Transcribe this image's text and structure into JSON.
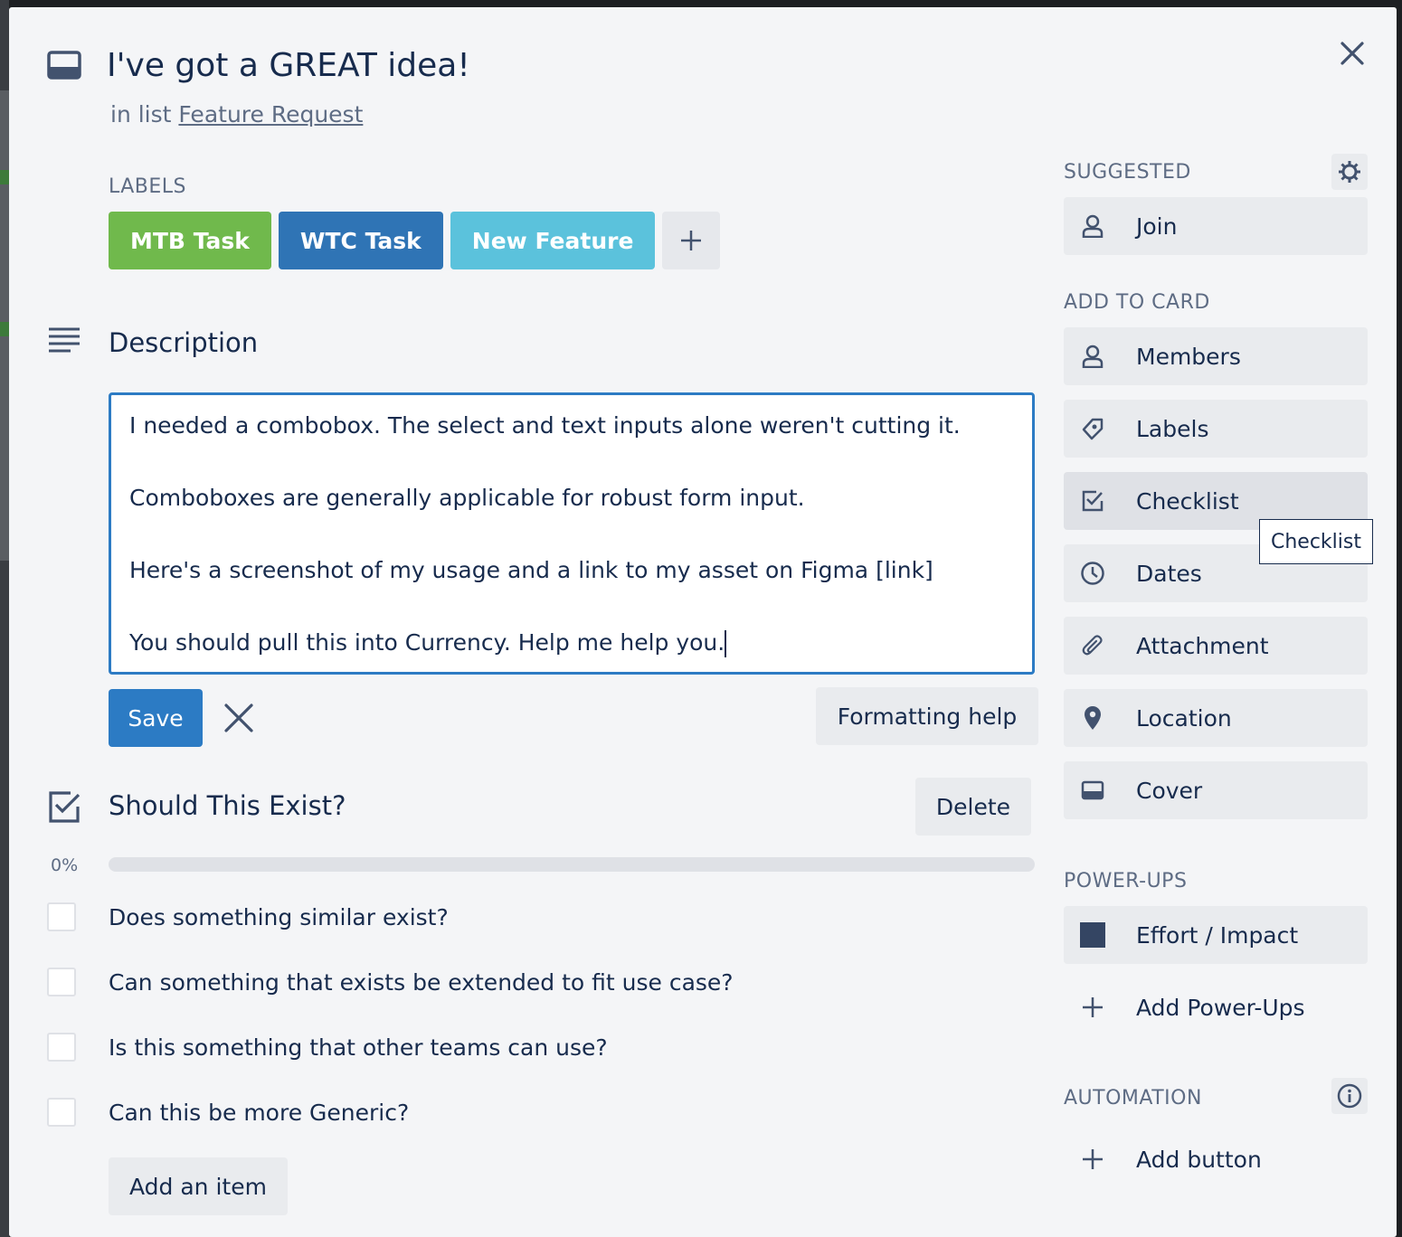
{
  "card": {
    "title": "I've got a GREAT idea!",
    "list_prefix": "in list",
    "list_name": "Feature Request"
  },
  "labels": {
    "heading": "LABELS",
    "items": [
      {
        "text": "MTB Task",
        "color": "#70b94c"
      },
      {
        "text": "WTC Task",
        "color": "#2f74b5"
      },
      {
        "text": "New Feature",
        "color": "#5bc2dc"
      }
    ]
  },
  "description": {
    "heading": "Description",
    "lines": [
      "I needed a combobox. The select and text inputs alone weren't cutting it.",
      "Comboboxes are generally applicable for robust form input.",
      "Here's a screenshot of my usage and a link to my asset on Figma [link]",
      "You should pull this into Currency. Help me help you."
    ],
    "save_label": "Save",
    "formatting_help_label": "Formatting help"
  },
  "checklist": {
    "title": "Should This Exist?",
    "delete_label": "Delete",
    "progress_text": "0%",
    "progress_value": 0,
    "items": [
      {
        "text": "Does something similar exist?",
        "checked": false
      },
      {
        "text": "Can something that exists be extended to fit use case?",
        "checked": false
      },
      {
        "text": "Is this something that other teams can use?",
        "checked": false
      },
      {
        "text": "Can this be more Generic?",
        "checked": false
      }
    ],
    "add_item_label": "Add an item"
  },
  "sidebar": {
    "suggested_heading": "SUGGESTED",
    "join_label": "Join",
    "add_to_card_heading": "ADD TO CARD",
    "add_to_card": [
      {
        "label": "Members",
        "icon": "person-icon"
      },
      {
        "label": "Labels",
        "icon": "tag-icon"
      },
      {
        "label": "Checklist",
        "icon": "checkbox-icon"
      },
      {
        "label": "Dates",
        "icon": "clock-icon"
      },
      {
        "label": "Attachment",
        "icon": "paperclip-icon"
      },
      {
        "label": "Location",
        "icon": "pin-icon"
      },
      {
        "label": "Cover",
        "icon": "card-cover-icon"
      }
    ],
    "powerups_heading": "POWER-UPS",
    "effort_label": "Effort / Impact",
    "add_powerups_label": "Add Power-Ups",
    "automation_heading": "AUTOMATION",
    "add_button_label": "Add button",
    "tooltip_text": "Checklist"
  }
}
